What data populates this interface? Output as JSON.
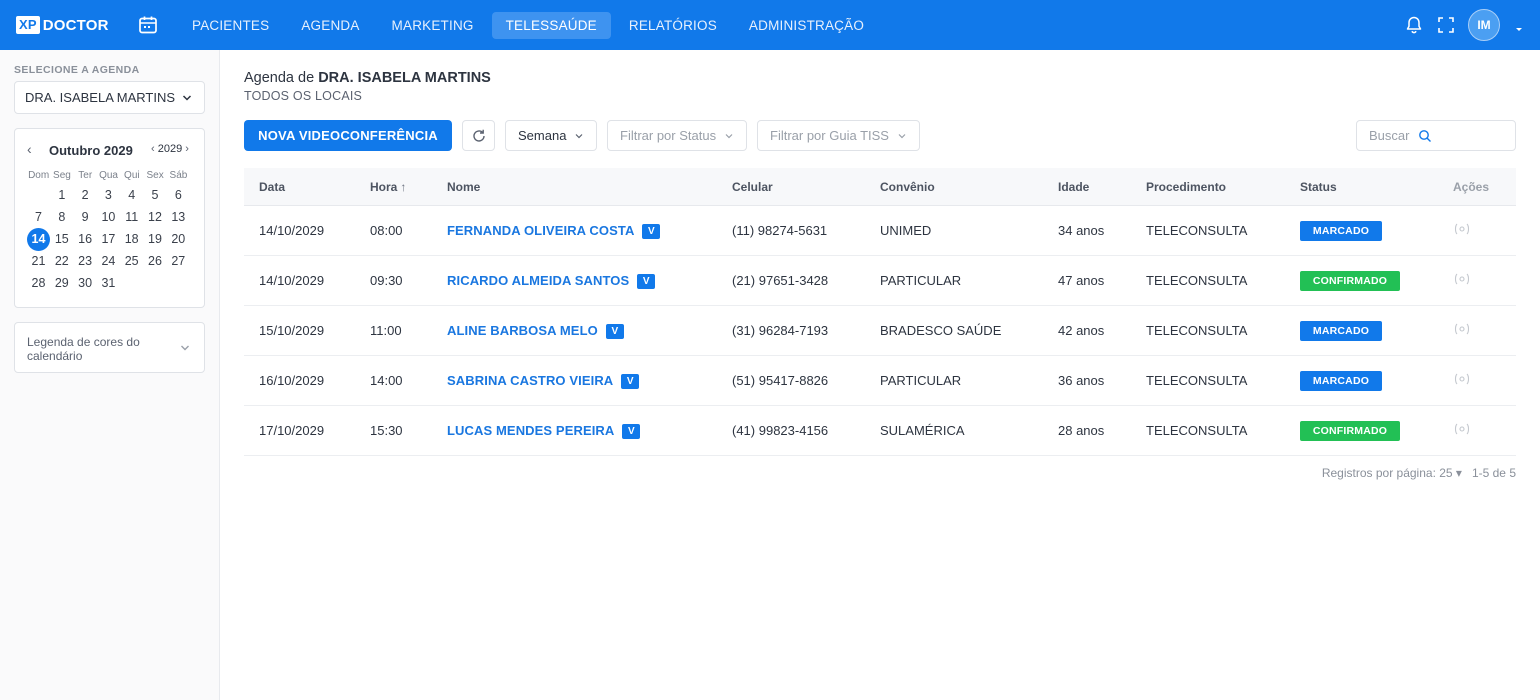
{
  "app": {
    "logo_xp": "XP",
    "logo_doctor": "DOCTOR"
  },
  "nav": {
    "items": [
      "PACIENTES",
      "AGENDA",
      "MARKETING",
      "TELESSAÚDE",
      "RELATÓRIOS",
      "ADMINISTRAÇÃO"
    ],
    "active": "TELESSAÚDE"
  },
  "user": {
    "initials": "IM"
  },
  "sidebar": {
    "select_label": "SELECIONE A AGENDA",
    "selected_agenda": "DRA. ISABELA MARTINS",
    "calendar": {
      "month": "Outubro 2029",
      "year": "2029",
      "prev": "‹",
      "next": "›",
      "weekdays": [
        "Dom",
        "Seg",
        "Ter",
        "Qua",
        "Qui",
        "Sex",
        "Sáb"
      ],
      "first_weekday": 1,
      "days_in_month": 31,
      "selected_day": 14
    },
    "legend": "Legenda de cores do calendário"
  },
  "main": {
    "title_prefix": "Agenda de ",
    "doctor": "DRA. ISABELA MARTINS",
    "location": "TODOS OS LOCAIS",
    "new_button": "NOVA VIDEOCONFERÊNCIA",
    "view_select": "Semana",
    "status_filter_placeholder": "Filtrar por Status",
    "tiss_filter_placeholder": "Filtrar por Guia TISS",
    "search_placeholder": "Buscar"
  },
  "table": {
    "columns": [
      "Data",
      "Hora",
      "Nome",
      "Celular",
      "Convênio",
      "Idade",
      "Procedimento",
      "Status",
      "Ações"
    ],
    "sort_indicator": "↑",
    "badge": "V",
    "rows": [
      {
        "data": "14/10/2029",
        "hora": "08:00",
        "nome": "FERNANDA OLIVEIRA COSTA",
        "celular": "(11) 98274-5631",
        "convenio": "UNIMED",
        "idade": "34 anos",
        "procedimento": "TELECONSULTA",
        "status": "MARCADO",
        "status_key": "marcado"
      },
      {
        "data": "14/10/2029",
        "hora": "09:30",
        "nome": "RICARDO ALMEIDA SANTOS",
        "celular": "(21) 97651-3428",
        "convenio": "PARTICULAR",
        "idade": "47 anos",
        "procedimento": "TELECONSULTA",
        "status": "CONFIRMADO",
        "status_key": "confirmado"
      },
      {
        "data": "15/10/2029",
        "hora": "11:00",
        "nome": "ALINE BARBOSA MELO",
        "celular": "(31) 96284-7193",
        "convenio": "BRADESCO SAÚDE",
        "idade": "42 anos",
        "procedimento": "TELECONSULTA",
        "status": "MARCADO",
        "status_key": "marcado"
      },
      {
        "data": "16/10/2029",
        "hora": "14:00",
        "nome": "SABRINA CASTRO VIEIRA",
        "celular": "(51) 95417-8826",
        "convenio": "PARTICULAR",
        "idade": "36 anos",
        "procedimento": "TELECONSULTA",
        "status": "MARCADO",
        "status_key": "marcado"
      },
      {
        "data": "17/10/2029",
        "hora": "15:30",
        "nome": "LUCAS MENDES PEREIRA",
        "celular": "(41) 99823-4156",
        "convenio": "SULAMÉRICA",
        "idade": "28 anos",
        "procedimento": "TELECONSULTA",
        "status": "CONFIRMADO",
        "status_key": "confirmado"
      }
    ]
  },
  "pager": {
    "per_page": "Registros por página: 25 ▾",
    "range": "1-5 de 5"
  },
  "colors": {
    "primary": "#1179ea",
    "marcado": "#1179ea",
    "confirmado": "#22c055"
  }
}
